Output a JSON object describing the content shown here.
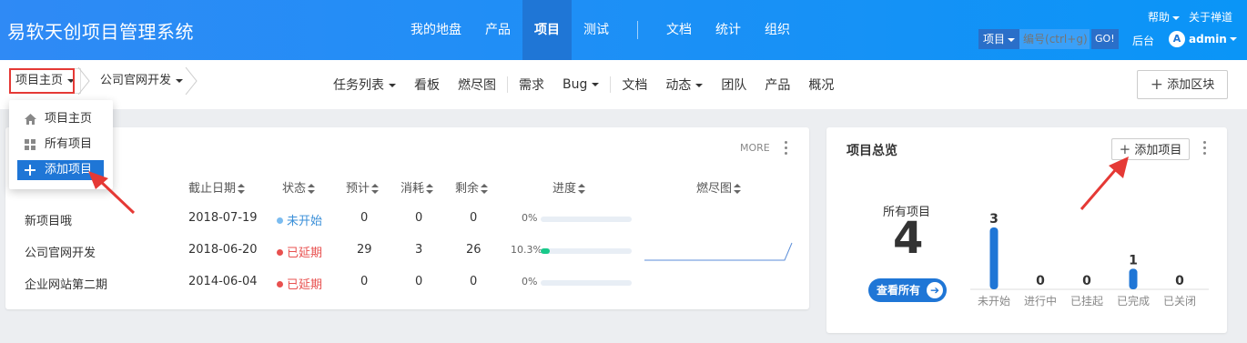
{
  "brand": "易软天创项目管理系统",
  "main_nav": [
    "我的地盘",
    "产品",
    "项目",
    "测试",
    "文档",
    "统计",
    "组织"
  ],
  "main_nav_active": "项目",
  "top_links": {
    "help": "帮助",
    "about": "关于禅道"
  },
  "search": {
    "type": "项目",
    "placeholder": "编号(ctrl+g)",
    "go": "GO!"
  },
  "backstage": "后台",
  "user": {
    "initial": "A",
    "name": "admin"
  },
  "breadcrumb": {
    "home": "项目主页",
    "project": "公司官网开发"
  },
  "sub_nav": {
    "task_list": "任务列表",
    "kanban": "看板",
    "burndown": "燃尽图",
    "story": "需求",
    "bug": "Bug",
    "doc": "文档",
    "dynamic": "动态",
    "team": "团队",
    "product": "产品",
    "overview": "概况"
  },
  "add_block": "添加区块",
  "dropdown": {
    "home": "项目主页",
    "all": "所有项目",
    "add": "添加项目"
  },
  "list_panel": {
    "more": "MORE",
    "headers": {
      "deadline": "截止日期",
      "status": "状态",
      "estimate": "预计",
      "consumed": "消耗",
      "left": "剩余",
      "progress": "进度",
      "burn": "燃尽图"
    },
    "rows": [
      {
        "name": "新项目哦",
        "deadline": "2018-07-19",
        "status": "未开始",
        "status_color": "#7bbcf0",
        "status_text_color": "#3a8fd8",
        "estimate": "0",
        "consumed": "0",
        "left": "0",
        "progress": "0%",
        "progress_value": 0
      },
      {
        "name": "公司官网开发",
        "deadline": "2018-06-20",
        "status": "已延期",
        "status_color": "#e8504f",
        "status_text_color": "#e8504f",
        "estimate": "29",
        "consumed": "3",
        "left": "26",
        "progress": "10.3%",
        "progress_value": 10.3
      },
      {
        "name": "企业网站第二期",
        "deadline": "2014-06-04",
        "status": "已延期",
        "status_color": "#e8504f",
        "status_text_color": "#e8504f",
        "estimate": "0",
        "consumed": "0",
        "left": "0",
        "progress": "0%",
        "progress_value": 0
      }
    ]
  },
  "overview_panel": {
    "title": "项目总览",
    "add_project": "添加项目",
    "all_label": "所有项目",
    "all_count": "4",
    "view_all": "查看所有"
  },
  "chart_data": {
    "type": "bar",
    "categories": [
      "未开始",
      "进行中",
      "已挂起",
      "已完成",
      "已关闭"
    ],
    "values": [
      3,
      0,
      0,
      1,
      0
    ],
    "color": "#1f76d6"
  },
  "colors": {
    "header": "#1a8cf5",
    "accent": "#1f76d6",
    "progress": "#18c98a",
    "delayed": "#e8504f",
    "annotation_red": "#e53935"
  }
}
